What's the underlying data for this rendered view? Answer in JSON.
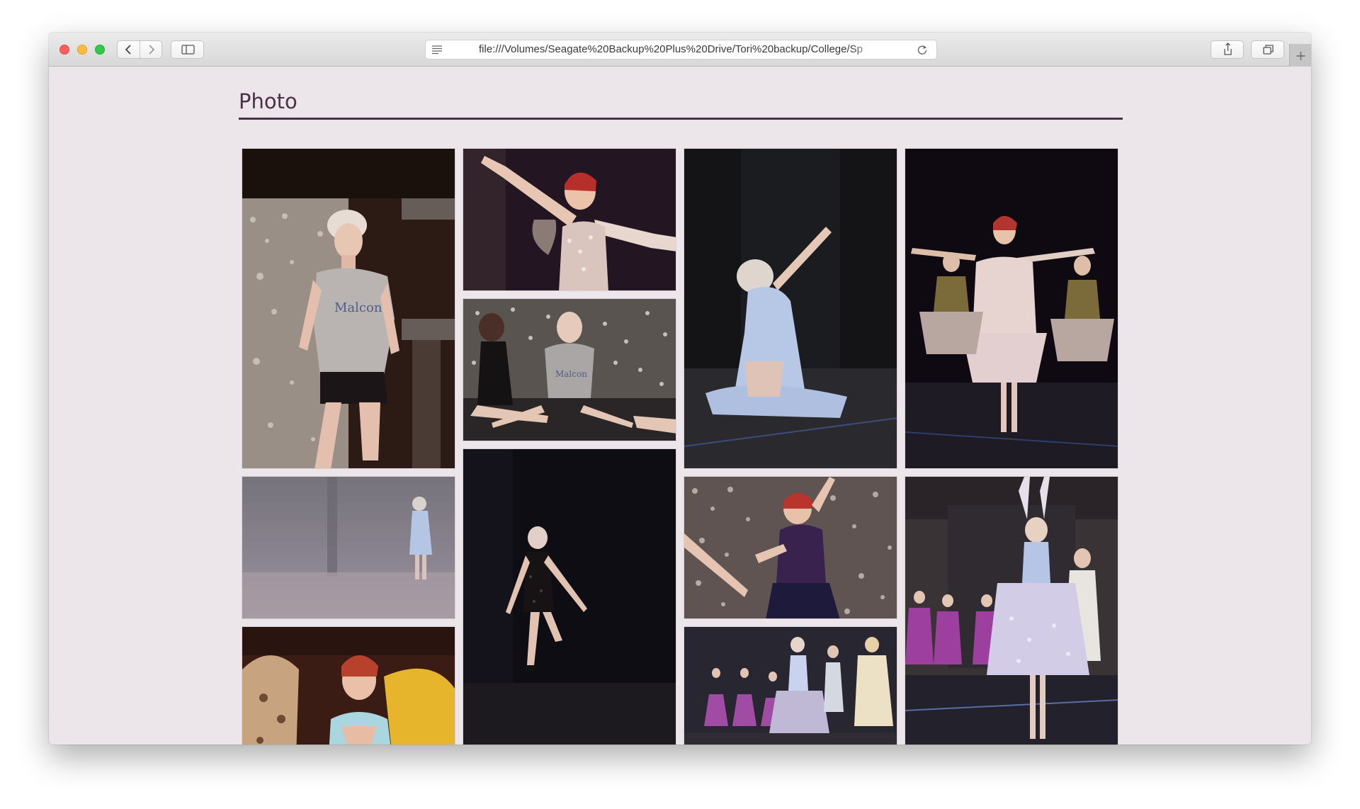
{
  "browser": {
    "url": "file:///Volumes/Seagate%20Backup%20Plus%20Drive/Tori%20backup/College/Sp"
  },
  "page": {
    "title": "Photo",
    "accent_color": "#4a3147",
    "background_color": "#ece6ea"
  },
  "gallery": {
    "photos": [
      {
        "subject": "blonde dancer in grey t-shirt on stage with sparkly backdrop"
      },
      {
        "subject": "red-haired fairy dancer with arms outstretched"
      },
      {
        "subject": "two dancers sitting in splits before sparkly backdrop"
      },
      {
        "subject": "blonde dancer in light blue dress kneeling on stage"
      },
      {
        "subject": "red-haired fairy dancer with two dancers in gold tutus"
      },
      {
        "subject": "dancer in light blue on misty stage"
      },
      {
        "subject": "blonde dancer in black fringe costume on dark stage"
      },
      {
        "subject": "red-haired dancer in purple sequin dress"
      },
      {
        "subject": "dancer in sparkly tutu leaping with young dancers in purple"
      },
      {
        "subject": "red-haired dancer in light blue with giraffe and lion props"
      },
      {
        "subject": "young dancers in purple tutus with dancer in silver tutu"
      }
    ]
  }
}
